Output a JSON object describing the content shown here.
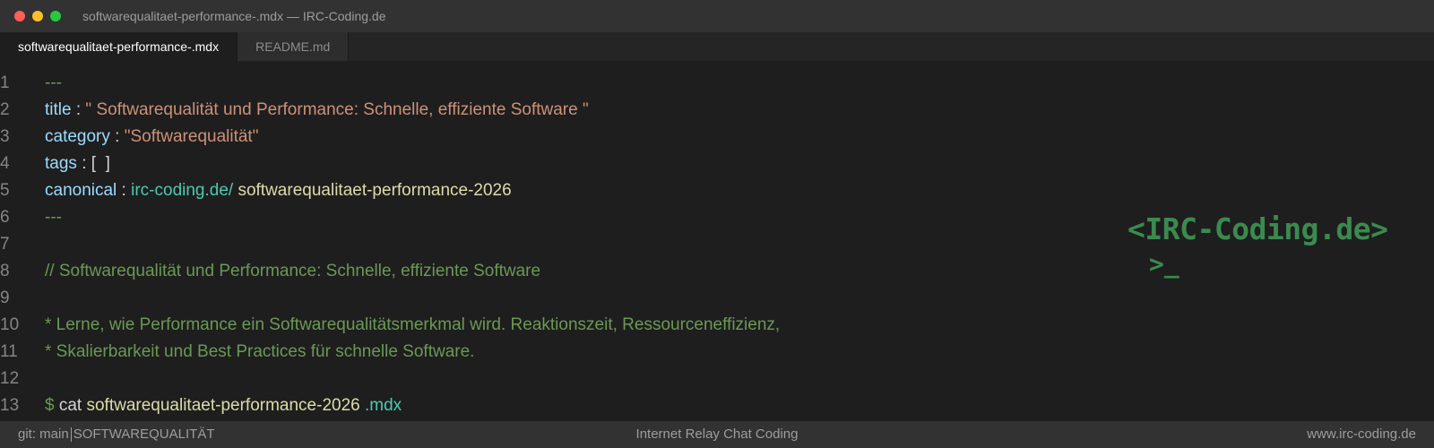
{
  "window": {
    "title": "softwarequalitaet-performance-.mdx — IRC-Coding.de"
  },
  "tabs": [
    {
      "label": "softwarequalitaet-performance-.mdx",
      "active": true
    },
    {
      "label": "README.md",
      "active": false
    }
  ],
  "editor": {
    "line_numbers": [
      "1",
      "2",
      "3",
      "4",
      "5",
      "6",
      "7",
      "8",
      "9",
      "10",
      "11",
      "12",
      "13"
    ],
    "lines": {
      "l1": {
        "dashes": "---"
      },
      "l2": {
        "key": "title",
        "colon": " : ",
        "value": "\" Softwarequalität und Performance: Schnelle, effiziente Software \""
      },
      "l3": {
        "key": "category",
        "colon": " : ",
        "value": "\"Softwarequalität\""
      },
      "l4": {
        "key": "tags",
        "colon": " : ",
        "value": "[  ]"
      },
      "l5": {
        "key": "canonical",
        "colon": " : ",
        "url": "irc-coding.de/",
        "slug": " softwarequalitaet-performance-2026"
      },
      "l6": {
        "dashes": "---"
      },
      "l8": {
        "comment": "// Softwarequalität und Performance: Schnelle, effiziente Software"
      },
      "l10": {
        "text": "* Lerne, wie Performance ein Softwarequalitätsmerkmal wird. Reaktionszeit, Ressourceneffizienz,"
      },
      "l11": {
        "text": "* Skalierbarkeit und Best Practices für schnelle Software."
      },
      "l13": {
        "prompt": "$",
        "cmd": " cat ",
        "file": "softwarequalitaet-performance-2026",
        "ext": " .mdx"
      }
    }
  },
  "logo": {
    "text": "<IRC-Coding.de>",
    "prompt": ">_"
  },
  "statusbar": {
    "branch": "git: main",
    "category": "SOFTWAREQUALITÄT",
    "center": "Internet Relay Chat Coding",
    "right": "www.irc-coding.de"
  },
  "colors": {
    "background": "#1e1e1e",
    "titlebar": "#323233",
    "key": "#9cdcfe",
    "string": "#ce9178",
    "comment": "#6a9955",
    "url": "#4ec9b0",
    "slug": "#dcdcaa",
    "logo": "#3b8a4f"
  }
}
